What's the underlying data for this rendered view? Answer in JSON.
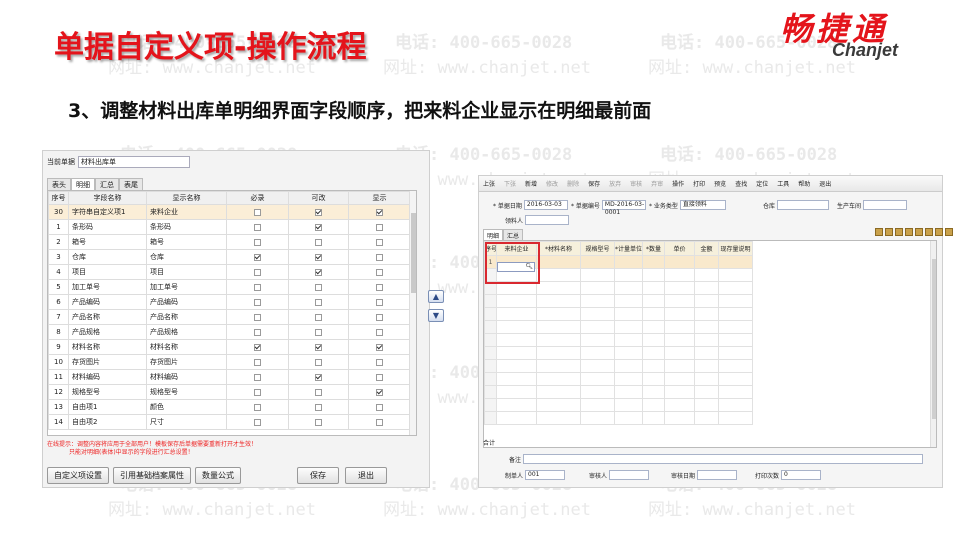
{
  "header": {
    "title": "单据自定义项-操作流程",
    "logo_cn": "畅捷通",
    "logo_en": "Chanjet",
    "subtitle": "3、调整材料出库单明细界面字段顺序，把来料企业显示在明细最前面"
  },
  "watermark": {
    "phone": "电话: 400-665-0028",
    "site": "网址: www.chanjet.net"
  },
  "left_window": {
    "doc_label": "当前单据",
    "doc_value": "材料出库单",
    "tabs": [
      "表头",
      "明细",
      "汇总",
      "表尾"
    ],
    "active_tab": 1,
    "columns": [
      "序号",
      "字段名称",
      "显示名称",
      "必录",
      "可改",
      "显示"
    ],
    "rows": [
      {
        "no": "30",
        "field": "字符串自定义项1",
        "display": "来料企业",
        "req": false,
        "edit": true,
        "show": true,
        "highlight": true
      },
      {
        "no": "1",
        "field": "条形码",
        "display": "条形码",
        "req": false,
        "edit": true,
        "show": false
      },
      {
        "no": "2",
        "field": "箱号",
        "display": "箱号",
        "req": false,
        "edit": false,
        "show": false
      },
      {
        "no": "3",
        "field": "仓库",
        "display": "仓库",
        "req": true,
        "edit": true,
        "show": false
      },
      {
        "no": "4",
        "field": "项目",
        "display": "项目",
        "req": false,
        "edit": true,
        "show": false
      },
      {
        "no": "5",
        "field": "加工单号",
        "display": "加工单号",
        "req": false,
        "edit": false,
        "show": false
      },
      {
        "no": "6",
        "field": "产品编码",
        "display": "产品编码",
        "req": false,
        "edit": false,
        "show": false
      },
      {
        "no": "7",
        "field": "产品名称",
        "display": "产品名称",
        "req": false,
        "edit": false,
        "show": false
      },
      {
        "no": "8",
        "field": "产品规格",
        "display": "产品规格",
        "req": false,
        "edit": false,
        "show": false
      },
      {
        "no": "9",
        "field": "材料名称",
        "display": "材料名称",
        "req": true,
        "edit": true,
        "show": true
      },
      {
        "no": "10",
        "field": "存货图片",
        "display": "存货图片",
        "req": false,
        "edit": false,
        "show": false
      },
      {
        "no": "11",
        "field": "材料编码",
        "display": "材料编码",
        "req": false,
        "edit": true,
        "show": false
      },
      {
        "no": "12",
        "field": "规格型号",
        "display": "规格型号",
        "req": false,
        "edit": false,
        "show": true
      },
      {
        "no": "13",
        "field": "自由项1",
        "display": "颜色",
        "req": false,
        "edit": false,
        "show": false
      },
      {
        "no": "14",
        "field": "自由项2",
        "display": "尺寸",
        "req": false,
        "edit": false,
        "show": false
      }
    ],
    "hint_line1": "在线提示：调整内容将应用于全部用户！模板保存后单据需要重新打开才生效！",
    "hint_line2": "只能对明细(表体)中显示的字段进行汇总设置！",
    "buttons": {
      "custom": "自定义项设置",
      "ref": "引用基础档案属性",
      "formula": "数量公式",
      "save": "保存",
      "exit": "退出"
    },
    "arrow_up": "▲",
    "arrow_down": "▼"
  },
  "right_window": {
    "toolbar": [
      "上张",
      "下张",
      "新增",
      "修改",
      "删除",
      "保存",
      "放弃",
      "审核",
      "弃审",
      "操作",
      "打印",
      "预览",
      "查找",
      "定位",
      "工具",
      "帮助",
      "退出"
    ],
    "toolbar_dim": [
      1,
      3,
      4,
      6,
      7,
      8
    ],
    "fields": {
      "date_label": "* 单据日期",
      "date_value": "2016-03-03",
      "no_label": "* 单据编号",
      "no_value": "MD-2016-03-0001",
      "biz_label": "* 业务类型",
      "biz_value": "直接领料",
      "warehouse_label": "仓库",
      "workshop_label": "生产车间",
      "picker_label": "领料人"
    },
    "tabs": [
      "明细",
      "汇总"
    ],
    "grid_columns": [
      "序号",
      "来料企业",
      "*材料名称",
      "规格型号",
      "*计量单位",
      "*数量",
      "单价",
      "金额",
      "现存量说明"
    ],
    "first_row_no": "1",
    "total_label": "合计",
    "remark_label": "备注",
    "footer": {
      "maker_label": "制单人",
      "maker_value": "001",
      "auditor_label": "审核人",
      "audit_date_label": "审核日期",
      "print_label": "打印次数",
      "print_value": "0"
    }
  }
}
